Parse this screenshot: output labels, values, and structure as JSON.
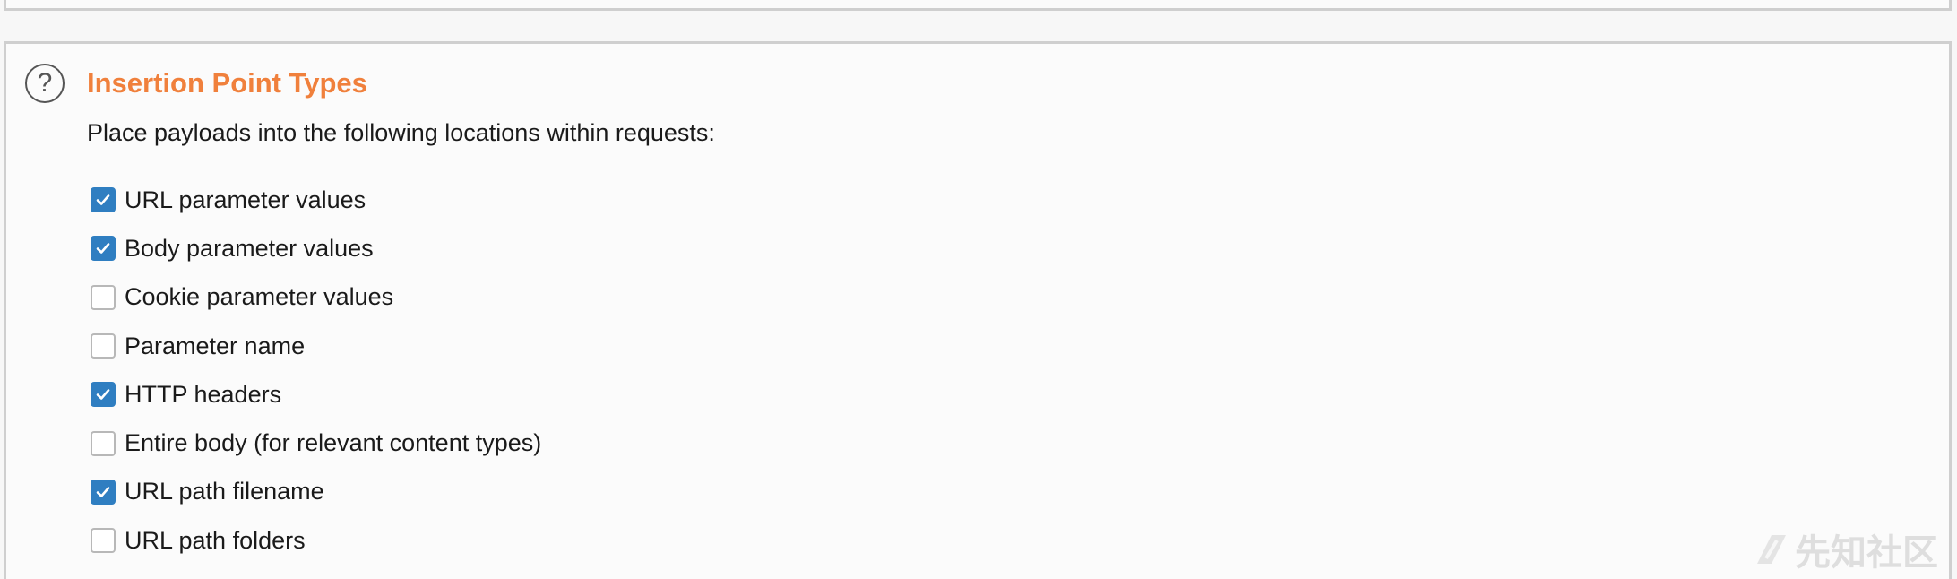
{
  "section": {
    "title": "Insertion Point Types",
    "help_icon": "question-circle-icon",
    "description": "Place payloads into the following locations within requests:"
  },
  "options": [
    {
      "label": "URL parameter values",
      "checked": true
    },
    {
      "label": "Body parameter values",
      "checked": true
    },
    {
      "label": "Cookie parameter values",
      "checked": false
    },
    {
      "label": "Parameter name",
      "checked": false
    },
    {
      "label": "HTTP headers",
      "checked": true
    },
    {
      "label": "Entire body (for relevant content types)",
      "checked": false
    },
    {
      "label": "URL path filename",
      "checked": true
    },
    {
      "label": "URL path folders",
      "checked": false
    }
  ],
  "watermark": {
    "text": "先知社区"
  },
  "colors": {
    "title": "#f0803c",
    "checkbox_checked": "#2f7ec1",
    "panel_border": "#cfcfcf"
  }
}
